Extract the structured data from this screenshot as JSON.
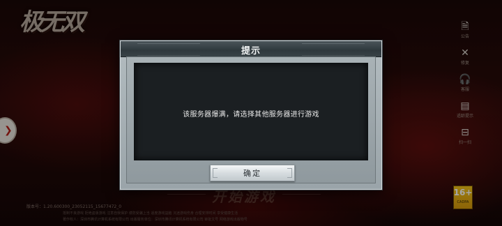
{
  "game": {
    "logo_text": "极无双"
  },
  "side_menu": {
    "items": [
      {
        "icon": "notice-icon",
        "glyph": "🗎",
        "label": "公告"
      },
      {
        "icon": "repair-icon",
        "glyph": "✕",
        "label": "修复"
      },
      {
        "icon": "headset-icon",
        "glyph": "🎧",
        "label": "客服"
      },
      {
        "icon": "age-tip-icon",
        "glyph": "▤",
        "label": "适龄提示"
      },
      {
        "icon": "scan-icon",
        "glyph": "⊟",
        "label": "扫一扫"
      }
    ]
  },
  "start_banner": "开始游戏",
  "version_text": "版本号：1.20.600300_23052115_15677472_0",
  "footer_lines": [
    "抵制不良游戏 拒绝盗版游戏 注意自我保护 谨防受骗上当 适度游戏益脑 沉迷游戏伤身 合理安排时间 享受健康生活",
    "著作权人：深圳市腾讯计算机系统有限公司 出版服务单位：深圳市腾讯计算机系统有限公司 审批文号 网络游戏出版物号"
  ],
  "age_rating": {
    "number": "16+",
    "label": "CADPA"
  },
  "dialog": {
    "title": "提示",
    "message": "该服务器爆满，请选择其他服务器进行游戏",
    "confirm_label": "确定"
  },
  "colors": {
    "dialog_frame": "#9aa4a9",
    "dialog_header": "#2f383d",
    "dialog_body": "#1b1f22",
    "accent_red": "#b32018"
  }
}
